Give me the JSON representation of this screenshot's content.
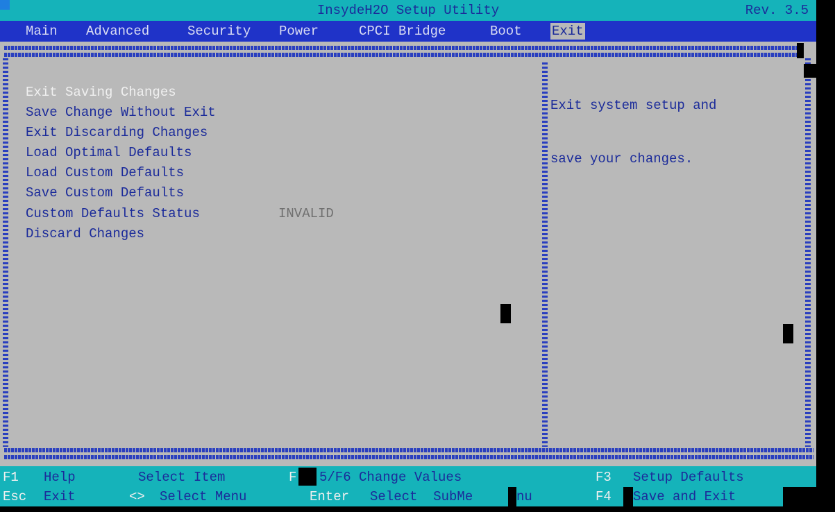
{
  "title": "InsydeH2O Setup Utility",
  "revision": "Rev. 3.5",
  "menu": {
    "tabs": [
      "Main",
      "Advanced",
      "Security",
      "Power",
      "CPCI Bridge",
      "Boot",
      "Exit"
    ],
    "active": "Exit"
  },
  "items": [
    "Exit Saving Changes",
    "Save Change Without Exit",
    "Exit Discarding Changes",
    "Load Optimal Defaults",
    "Load Custom Defaults",
    "Save Custom Defaults",
    "Custom Defaults Status",
    "Discard Changes"
  ],
  "selected_item": "Exit Saving Changes",
  "custom_defaults_status_value": "INVALID",
  "help": {
    "line1": "Exit system setup and",
    "line2": "save your changes."
  },
  "footer": {
    "row1": [
      {
        "key": "F1",
        "desc": "Help"
      },
      {
        "key": "",
        "desc": "Select Item"
      },
      {
        "key": "F",
        "desc": "5/F6 Change Values"
      },
      {
        "key": "F3",
        "desc": "Setup Defaults"
      }
    ],
    "row2": [
      {
        "key": "Esc",
        "desc": "Exit"
      },
      {
        "key": "<>",
        "desc": "Select Menu"
      },
      {
        "key": "Enter",
        "desc": "Select  SubMe"
      },
      {
        "key": "",
        "desc": "nu"
      },
      {
        "key": "F4",
        "desc": "Save and Exit"
      }
    ]
  },
  "colors": {
    "title_bg": "#15b3ba",
    "menu_bg": "#1f33c8",
    "panel_bg": "#b9b9b9",
    "text_blue": "#1b2b9a",
    "text_white": "#f0f0f0"
  }
}
